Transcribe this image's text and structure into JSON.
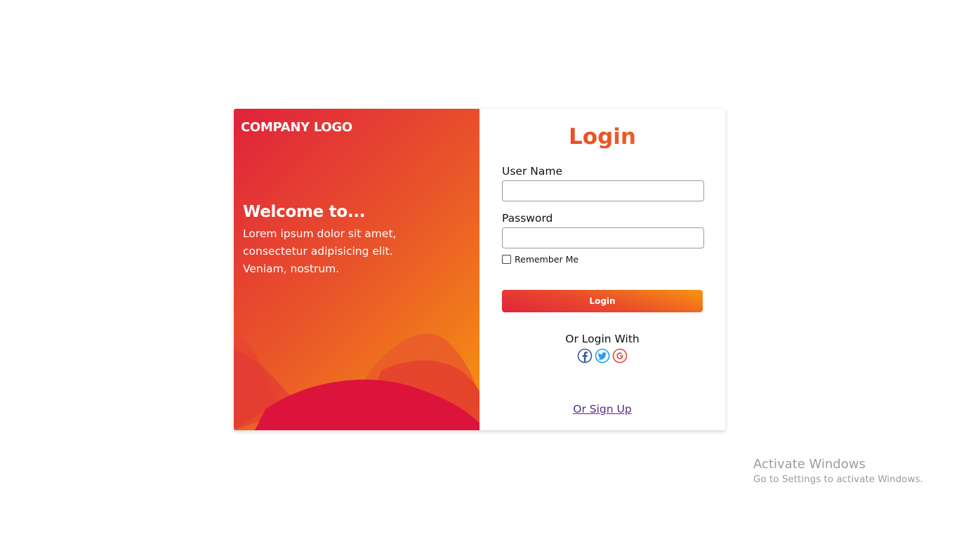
{
  "brand": {
    "logo_text": "COMPANY LOGO",
    "welcome_heading": "Welcome to...",
    "welcome_text": "Lorem ipsum dolor sit amet, consectetur adipisicing elit. Veniam, nostrum.",
    "colors": {
      "gradient_start": "#e0223c",
      "gradient_end": "#f7960f",
      "wave_dark": "#dc143c"
    }
  },
  "form": {
    "title": "Login",
    "username_label": "User Name",
    "username_value": "",
    "password_label": "Password",
    "password_value": "",
    "remember_label": "Remember Me",
    "remember_checked": false,
    "submit_label": "Login",
    "or_login_with": "Or Login With",
    "social": [
      "facebook-icon",
      "twitter-icon",
      "google-icon"
    ],
    "signup_link": "Or Sign Up",
    "accent_color": "#ee5a24"
  },
  "watermark": {
    "title": "Activate Windows",
    "subtitle": "Go to Settings to activate Windows."
  }
}
